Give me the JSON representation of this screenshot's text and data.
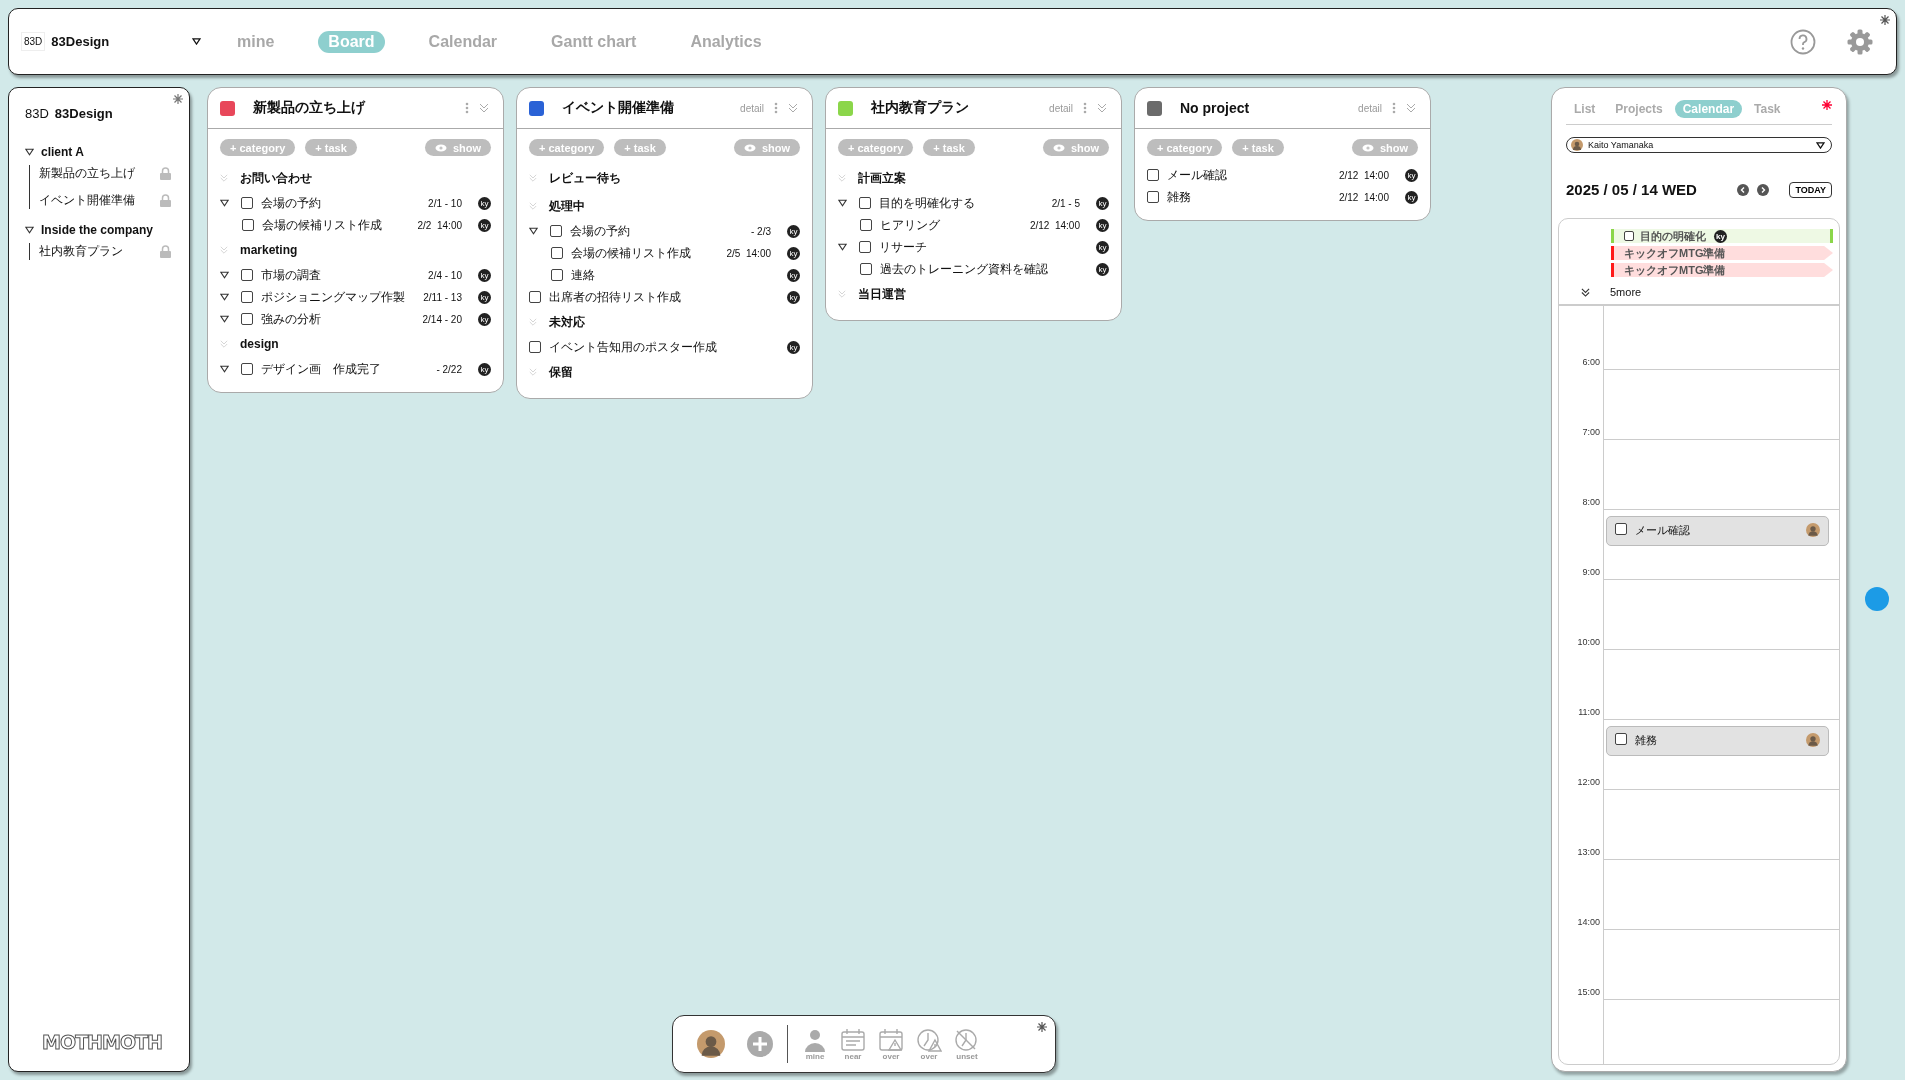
{
  "topbar": {
    "logo_mark": "83D",
    "workspace": "83Design",
    "tabs": [
      {
        "label": "mine",
        "selected": false
      },
      {
        "label": "Board",
        "selected": true
      },
      {
        "label": "Calendar",
        "selected": false
      },
      {
        "label": "Gantt chart",
        "selected": false
      },
      {
        "label": "Analytics",
        "selected": false
      }
    ]
  },
  "sidebar": {
    "logo_mark": "83D",
    "workspace": "83Design",
    "groups": [
      {
        "name": "client A",
        "expanded": true,
        "children": [
          {
            "name": "新製品の立ち上げ",
            "locked": true
          },
          {
            "name": "イベント開催準備",
            "locked": true
          }
        ]
      },
      {
        "name": "Inside the company",
        "expanded": true,
        "children": [
          {
            "name": "社内教育プラン",
            "locked": true
          }
        ]
      }
    ],
    "footer_logo": "MOTHMOTH"
  },
  "board": {
    "columns": [
      {
        "title": "新製品の立ち上げ",
        "color": "#e8475a",
        "buttons": {
          "category": "+ category",
          "task": "+ task",
          "show": "show"
        },
        "groups": [
          {
            "name": "お問い合わせ",
            "tasks": [
              {
                "name": "会場の予約",
                "date": "2/1 - 10",
                "assignee": "ky",
                "checked": false,
                "has_subtasks": true,
                "children": [
                  {
                    "name": "会場の候補リスト作成",
                    "date": "2/2  14:00",
                    "assignee": "ky",
                    "checked": false
                  }
                ]
              }
            ]
          },
          {
            "name": "marketing",
            "tasks": [
              {
                "name": "市場の調査",
                "date": "2/4 - 10",
                "assignee": "ky",
                "checked": false,
                "has_subtasks": true
              },
              {
                "name": "ポジショニングマップ作製",
                "date": "2/11 - 13",
                "assignee": "ky",
                "checked": false,
                "has_subtasks": true
              },
              {
                "name": "強みの分析",
                "date": "2/14 - 20",
                "assignee": "ky",
                "checked": false,
                "has_subtasks": true
              }
            ]
          },
          {
            "name": "design",
            "tasks": [
              {
                "name": "デザイン画　作成完了",
                "date": "- 2/22",
                "assignee": "ky",
                "checked": false,
                "has_subtasks": true
              }
            ]
          }
        ]
      },
      {
        "title": "イベント開催準備",
        "color": "#2a62d6",
        "detail": "detail",
        "buttons": {
          "category": "+ category",
          "task": "+ task",
          "show": "show"
        },
        "groups": [
          {
            "name": "レビュー待ち"
          },
          {
            "name": "処理中",
            "tasks": [
              {
                "name": "会場の予約",
                "date": "- 2/3",
                "assignee": "ky",
                "checked": false,
                "has_subtasks": true,
                "children": [
                  {
                    "name": "会場の候補リスト作成",
                    "date": "2/5  14:00",
                    "assignee": "ky",
                    "checked": false
                  },
                  {
                    "name": "連絡",
                    "assignee": "ky",
                    "checked": false
                  }
                ]
              },
              {
                "name": "出席者の招待リスト作成",
                "assignee": "ky",
                "checked": false,
                "has_subtasks": false
              }
            ]
          },
          {
            "name": "未対応",
            "tasks": [
              {
                "name": "イベント告知用のポスター作成",
                "assignee": "ky",
                "checked": false,
                "has_subtasks": false
              }
            ]
          },
          {
            "name": "保留"
          }
        ]
      },
      {
        "title": "社内教育プラン",
        "color": "#8bd64a",
        "detail": "detail",
        "buttons": {
          "category": "+ category",
          "task": "+ task",
          "show": "show"
        },
        "groups": [
          {
            "name": "計画立案",
            "tasks": [
              {
                "name": "目的を明確化する",
                "date": "2/1 - 5",
                "assignee": "ky",
                "checked": false,
                "has_subtasks": true,
                "children": [
                  {
                    "name": "ヒアリング",
                    "date": "2/12  14:00",
                    "assignee": "ky",
                    "checked": false
                  }
                ]
              },
              {
                "name": "リサーチ",
                "assignee": "ky",
                "checked": false,
                "has_subtasks": true,
                "children": [
                  {
                    "name": "過去のトレーニング資料を確認",
                    "assignee": "ky",
                    "checked": false
                  }
                ]
              }
            ]
          },
          {
            "name": "当日運営"
          }
        ]
      },
      {
        "title": "No project",
        "color": "#6b6b6b",
        "detail": "detail",
        "buttons": {
          "category": "+ category",
          "task": "+ task",
          "show": "show"
        },
        "tasks": [
          {
            "name": "メール確認",
            "date": "2/12  14:00",
            "assignee": "ky",
            "checked": false,
            "has_subtasks": false
          },
          {
            "name": "雑務",
            "date": "2/12  14:00",
            "assignee": "ky",
            "checked": false,
            "has_subtasks": false
          }
        ]
      }
    ]
  },
  "calendar_panel": {
    "tabs": [
      {
        "label": "List",
        "selected": false
      },
      {
        "label": "Projects",
        "selected": false
      },
      {
        "label": "Calendar",
        "selected": true
      },
      {
        "label": "Task",
        "selected": false
      }
    ],
    "user": {
      "name": "Kaito Yamanaka"
    },
    "date": "2025 / 05 / 14 WED",
    "today": "TODAY",
    "all_day": [
      {
        "kind": "task",
        "name": "目的の明確化",
        "color": "#8bd64a",
        "checked": false,
        "assignee": "ky"
      },
      {
        "kind": "event",
        "name": "キックオフMTG準備",
        "color": "#ff1a1a"
      },
      {
        "kind": "event",
        "name": "キックオフMTG準備",
        "color": "#ff1a1a"
      }
    ],
    "more": "5more",
    "hours": [
      {
        "label": "6:00"
      },
      {
        "label": "7:00"
      },
      {
        "label": "8:00",
        "events": [
          {
            "name": "メール確認",
            "checked": false
          }
        ]
      },
      {
        "label": "9:00"
      },
      {
        "label": "10:00"
      },
      {
        "label": "11:00",
        "events": [
          {
            "name": "雑務",
            "checked": false
          }
        ]
      },
      {
        "label": "12:00"
      },
      {
        "label": "13:00"
      },
      {
        "label": "14:00"
      },
      {
        "label": "15:00"
      }
    ]
  },
  "toolbar": {
    "filters": [
      {
        "kind": "person",
        "label": "mine"
      },
      {
        "kind": "calendar",
        "label": "near"
      },
      {
        "kind": "calendar-warning",
        "label": "over"
      },
      {
        "kind": "clock-warning",
        "label": "over"
      },
      {
        "kind": "clock-off",
        "label": "unset"
      }
    ]
  }
}
